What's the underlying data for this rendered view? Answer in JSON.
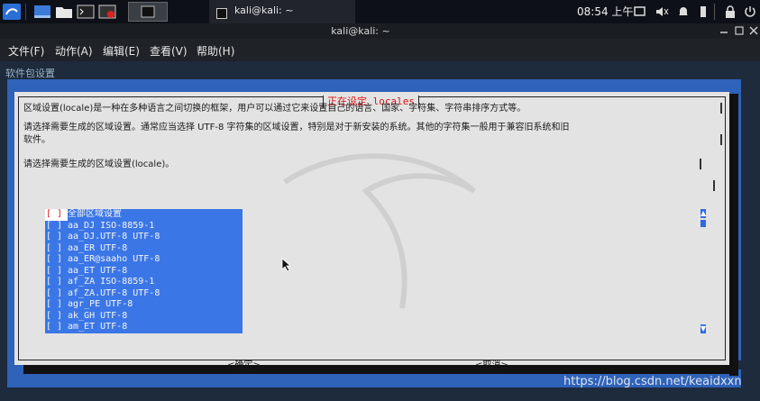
{
  "taskbar": {
    "window_title": "kali@kali: ~",
    "time": "08:54",
    "period": "上午"
  },
  "window": {
    "title": "kali@kali: ~"
  },
  "menu": {
    "file": "文件(F)",
    "actions": "动作(A)",
    "edit": "编辑(E)",
    "view": "查看(V)",
    "help": "帮助(H)"
  },
  "terminal": {
    "header": "软件包设置"
  },
  "dialog": {
    "title": "正在设定 locales",
    "line1": "区域设置(locale)是一种在多种语言之间切换的框架，用户可以通过它来设置自己的语言、国家、字符集、字符串排序方式等。",
    "line2a": "请选择需要生成的区域设置。通常应当选择 UTF-8 字符集的区域设置，特别是对于新安装的系统。其他的字符集一般用于兼容旧系统和旧",
    "line2b": "软件。",
    "line3": "请选择需要生成的区域设置(locale)。",
    "checkbox": "[ ]",
    "items": [
      "全部区域设置",
      "aa_DJ ISO-8859-1",
      "aa_DJ.UTF-8 UTF-8",
      "aa_ER UTF-8",
      "aa_ER@saaho UTF-8",
      "aa_ET UTF-8",
      "af_ZA ISO-8859-1",
      "af_ZA.UTF-8 UTF-8",
      "agr_PE UTF-8",
      "ak_GH UTF-8",
      "am_ET UTF-8"
    ],
    "ok": "<确定>",
    "cancel": "<取消>"
  },
  "watermark": "https://blog.csdn.net/keaidxxn",
  "colors": {
    "backdrop": "#2f62b9",
    "list_bg": "#3b76e6",
    "title_red": "#dd1111",
    "dialog_bg": "#e3e3e3"
  }
}
